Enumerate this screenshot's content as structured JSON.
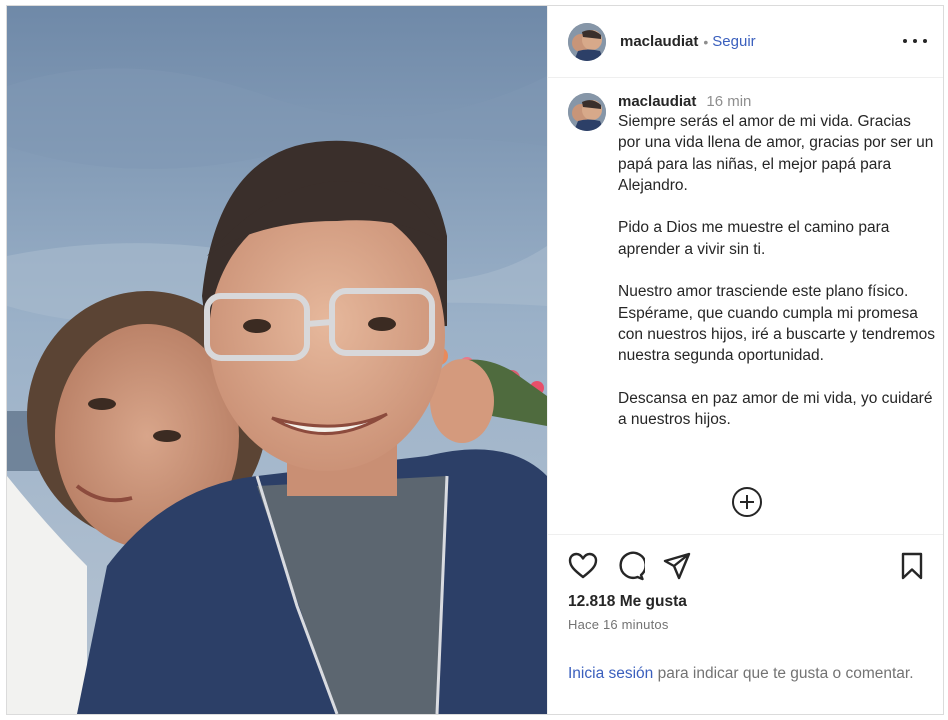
{
  "post": {
    "photo_icon": "selfie-photo",
    "author": {
      "username": "maclaudiat",
      "avatar_icon": "profile-avatar"
    },
    "header": {
      "separator": "•",
      "follow_label": "Seguir",
      "more_icon": "more-options-icon"
    },
    "caption": {
      "username": "maclaudiat",
      "time": "16 min",
      "paragraphs": [
        "Siempre serás el amor de mi vida. Gracias por una vida llena de amor, gracias por ser un papá para las niñas, el mejor papá para Alejandro.",
        "Pido a Dios me muestre el camino para aprender a vivir sin ti.",
        "Nuestro amor trasciende este plano físico. Espérame, que cuando cumpla mi promesa con nuestros hijos, iré a buscarte y tendremos nuestra segunda oportunidad.",
        "Descansa en paz amor de mi vida, yo cuidaré a nuestros hijos."
      ]
    },
    "load_more_icon": "plus-circle-icon",
    "actions": {
      "like_icon": "heart-icon",
      "comment_icon": "comment-icon",
      "share_icon": "share-icon",
      "save_icon": "bookmark-icon"
    },
    "likes_text": "12.818 Me gusta",
    "posted_ago": "Hace 16 minutos",
    "login_prompt": {
      "link": "Inicia sesión",
      "rest": " para indicar que te gusta o comentar."
    }
  }
}
